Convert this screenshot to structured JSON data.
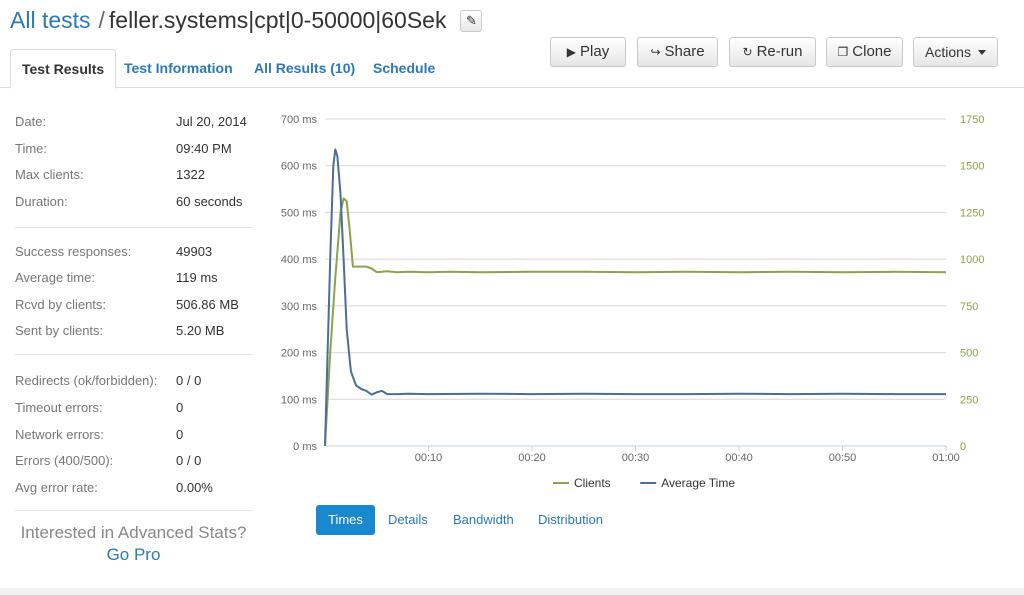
{
  "header": {
    "breadcrumb_link": "All tests",
    "separator": "/",
    "title": "feller.systems|cpt|0-50000|60Sek"
  },
  "toolbar": {
    "play_label": "Play",
    "share_label": "Share",
    "rerun_label": "Re-run",
    "clone_label": "Clone",
    "actions_label": "Actions"
  },
  "tabs": [
    {
      "label": "Test Results",
      "active": true
    },
    {
      "label": "Test Information"
    },
    {
      "label": "All Results (10)"
    },
    {
      "label": "Schedule"
    }
  ],
  "stats": [
    {
      "label": "Date:",
      "value": "Jul 20, 2014"
    },
    {
      "label": "Time:",
      "value": "09:40 PM"
    },
    {
      "label": "Max clients:",
      "value": "1322"
    },
    {
      "label": "Duration:",
      "value": "60 seconds"
    },
    {
      "label": "Success responses:",
      "value": "49903"
    },
    {
      "label": "Average time:",
      "value": "119 ms"
    },
    {
      "label": "Rcvd by clients:",
      "value": "506.86 MB"
    },
    {
      "label": "Sent by clients:",
      "value": "5.20 MB"
    },
    {
      "label": "Redirects (ok/forbidden):",
      "value": "0 / 0"
    },
    {
      "label": "Timeout errors:",
      "value": "0"
    },
    {
      "label": "Network errors:",
      "value": "0"
    },
    {
      "label": "Errors (400/500):",
      "value": "0 / 0"
    },
    {
      "label": "Avg error rate:",
      "value": "0.00%"
    }
  ],
  "promo": {
    "question": "Interested in Advanced Stats?",
    "link": "Go Pro"
  },
  "chart_tabs": [
    {
      "label": "Times",
      "active": true
    },
    {
      "label": "Details"
    },
    {
      "label": "Bandwidth"
    },
    {
      "label": "Distribution"
    }
  ],
  "colors": {
    "clients": "#8aa449",
    "avg_time": "#4a6e95",
    "link": "#2a7ab8",
    "active_tab": "#1a88cc"
  },
  "chart_data": {
    "type": "line",
    "x_ticks": [
      "00:10",
      "00:20",
      "00:30",
      "00:40",
      "00:50",
      "01:00"
    ],
    "y_left_ticks": [
      "700 ms",
      "600 ms",
      "500 ms",
      "400 ms",
      "300 ms",
      "200 ms",
      "100 ms",
      "0 ms"
    ],
    "y_right_ticks": [
      "1750",
      "1500",
      "1250",
      "1000",
      "750",
      "500",
      "250",
      "0"
    ],
    "ylim_left": [
      0,
      700
    ],
    "ylim_right": [
      0,
      1750
    ],
    "xlim": [
      0,
      60
    ],
    "grid": true,
    "legend_position": "bottom",
    "series": [
      {
        "name": "Clients",
        "axis": "right",
        "x": [
          0,
          0.5,
          1,
          1.5,
          1.8,
          2.1,
          2.4,
          2.7,
          3,
          3.5,
          4,
          4.5,
          5,
          6,
          7,
          8,
          10,
          12,
          15,
          20,
          25,
          30,
          35,
          40,
          45,
          50,
          55,
          60
        ],
        "values": [
          0,
          500,
          900,
          1250,
          1325,
          1310,
          1150,
          960,
          960,
          960,
          960,
          950,
          930,
          935,
          930,
          932,
          930,
          932,
          930,
          932,
          932,
          930,
          932,
          930,
          932,
          930,
          932,
          930
        ]
      },
      {
        "name": "Average Time",
        "axis": "left",
        "x": [
          0,
          0.5,
          0.8,
          1,
          1.2,
          1.5,
          1.8,
          2.1,
          2.5,
          3,
          3.5,
          4,
          4.5,
          5,
          5.5,
          6,
          7,
          8,
          10,
          15,
          20,
          25,
          30,
          35,
          40,
          45,
          50,
          55,
          60
        ],
        "values": [
          0,
          400,
          600,
          635,
          620,
          540,
          400,
          250,
          160,
          130,
          122,
          118,
          110,
          115,
          118,
          111,
          111,
          112,
          111,
          112,
          111,
          112,
          111,
          111,
          112,
          111,
          112,
          111,
          111
        ]
      }
    ]
  }
}
